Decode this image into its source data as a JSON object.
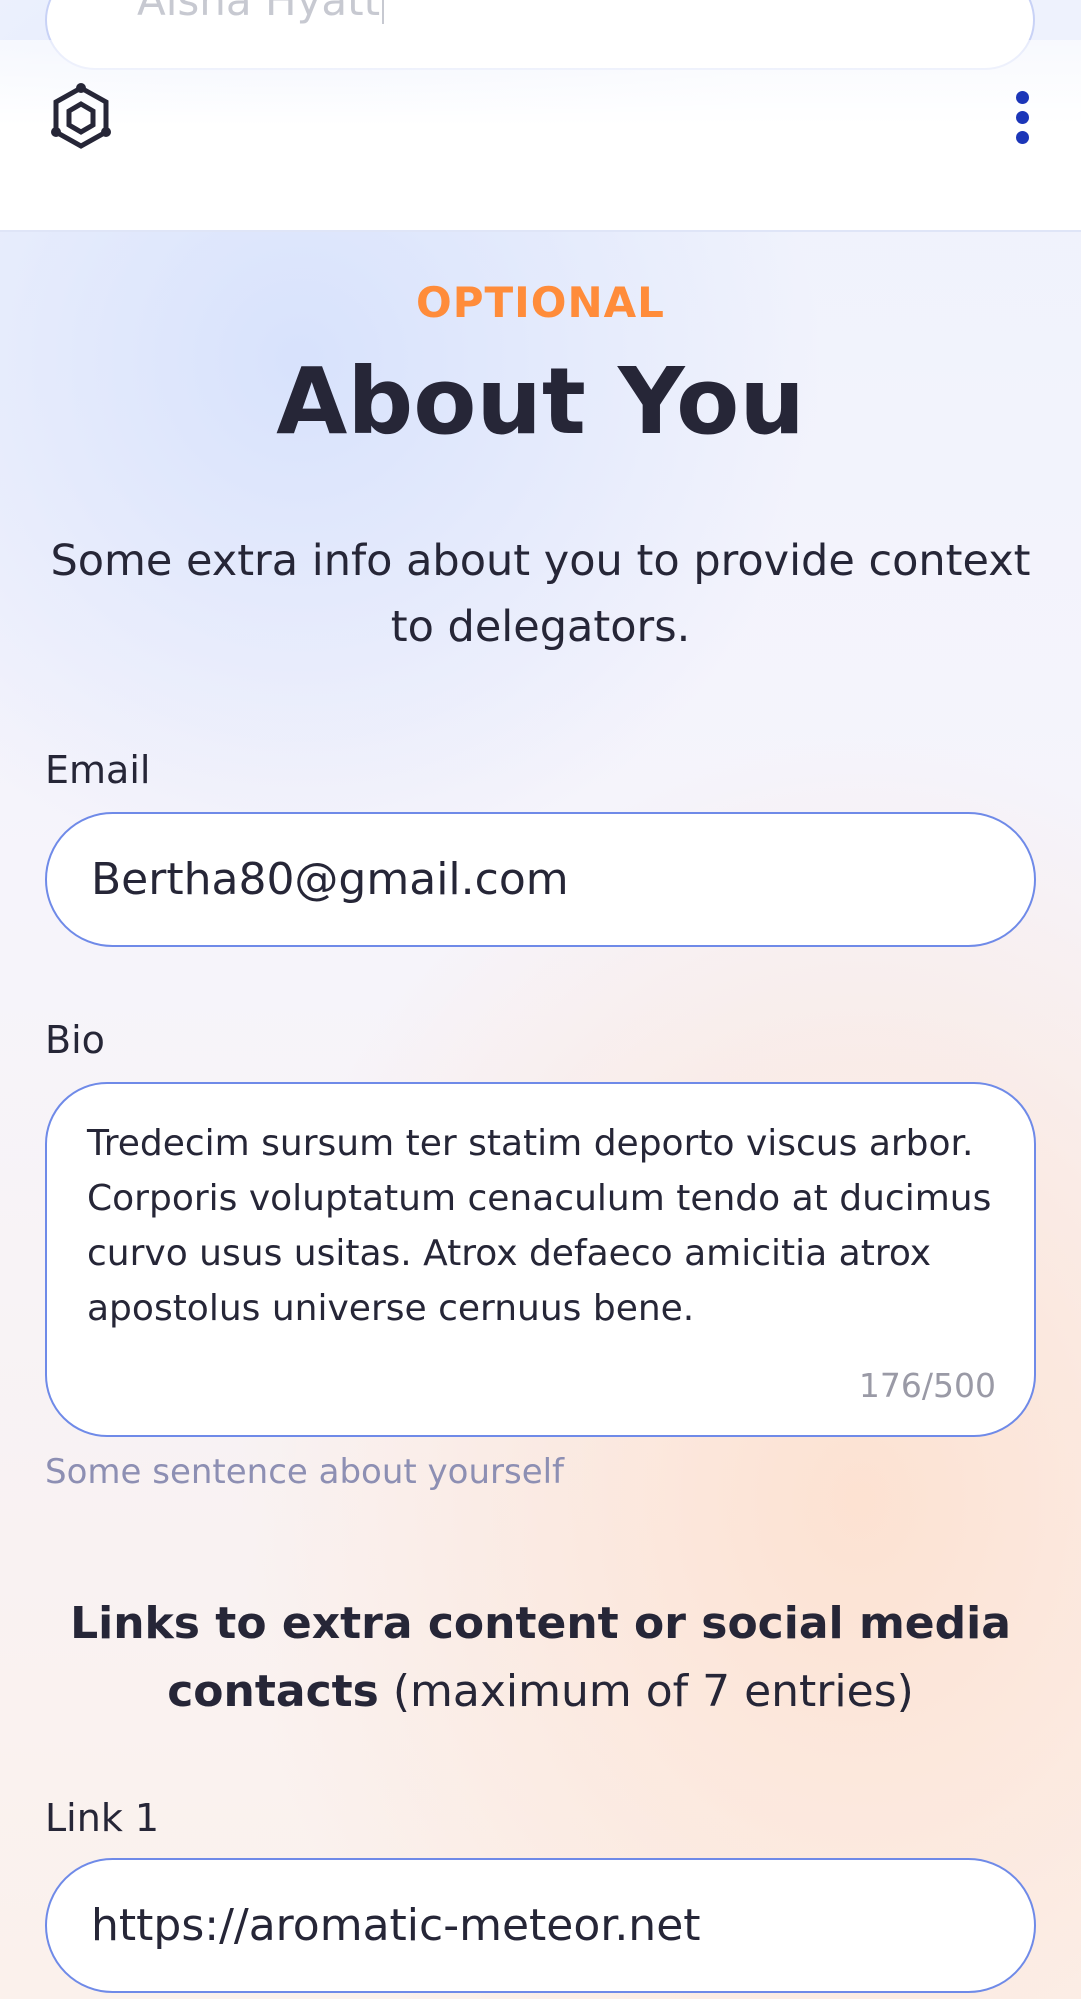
{
  "previous_field": {
    "value": "Aisha Hyatt"
  },
  "header": {
    "logo_icon": "hexagon-cluster-logo-icon",
    "menu_icon": "vertical-dots-menu-icon",
    "accent_color": "#1c36b8"
  },
  "section": {
    "eyebrow": "OPTIONAL",
    "title": "About You",
    "intro": "Some extra info about you to provide context to delegators.",
    "eyebrow_color": "#ff8c3a"
  },
  "email": {
    "label": "Email",
    "value": "Bertha80@gmail.com"
  },
  "bio": {
    "label": "Bio",
    "value": "Tredecim sursum ter statim deporto viscus arbor. Corporis voluptatum cenaculum tendo at ducimus curvo usus usitas. Atrox defaeco amicitia atrox apostolus universe cernuus bene.",
    "counter": "176/500",
    "hint": "Some sentence about yourself"
  },
  "links": {
    "heading_bold": "Links to extra content or social media contacts",
    "heading_note": "(maximum of 7 entries)",
    "items": [
      {
        "label": "Link 1",
        "value": "https://aromatic-meteor.net"
      }
    ]
  }
}
